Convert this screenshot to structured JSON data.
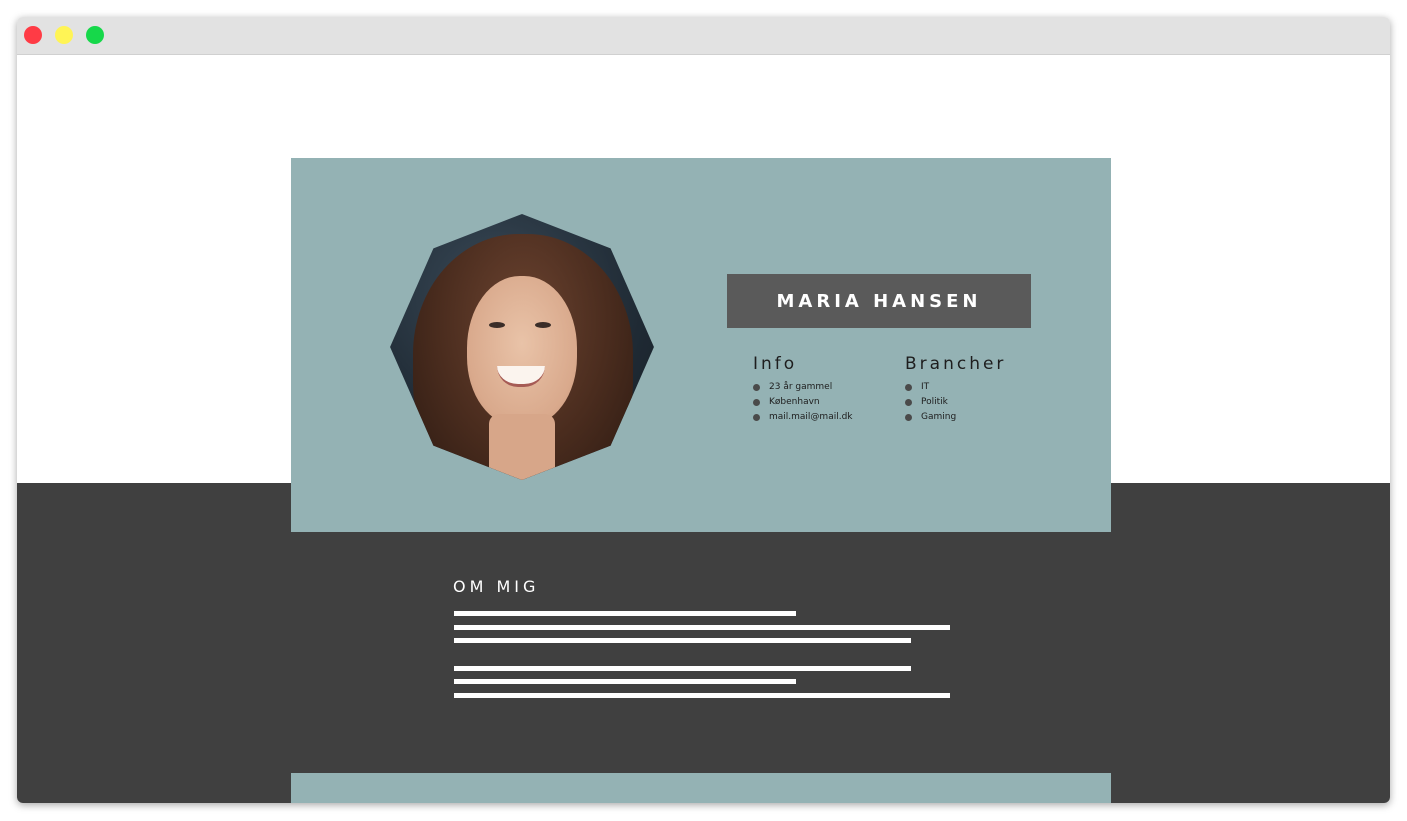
{
  "window": {
    "controls": [
      "close",
      "minimize",
      "maximize"
    ]
  },
  "colors": {
    "hero_bg": "#94b2b4",
    "dark_bg": "#404040",
    "name_box_bg": "#5a5a5a",
    "close": "#ff3b45",
    "minimize": "#fff455",
    "maximize": "#16d84a"
  },
  "profile": {
    "name": "MARIA HANSEN",
    "photo_icon": "portrait-photo"
  },
  "info": {
    "heading": "Info",
    "items": [
      "23 år gammel",
      "København",
      "mail.mail@mail.dk"
    ]
  },
  "brancher": {
    "heading": "Brancher",
    "items": [
      "IT",
      "Politik",
      "Gaming"
    ]
  },
  "about": {
    "heading": "OM MIG"
  }
}
